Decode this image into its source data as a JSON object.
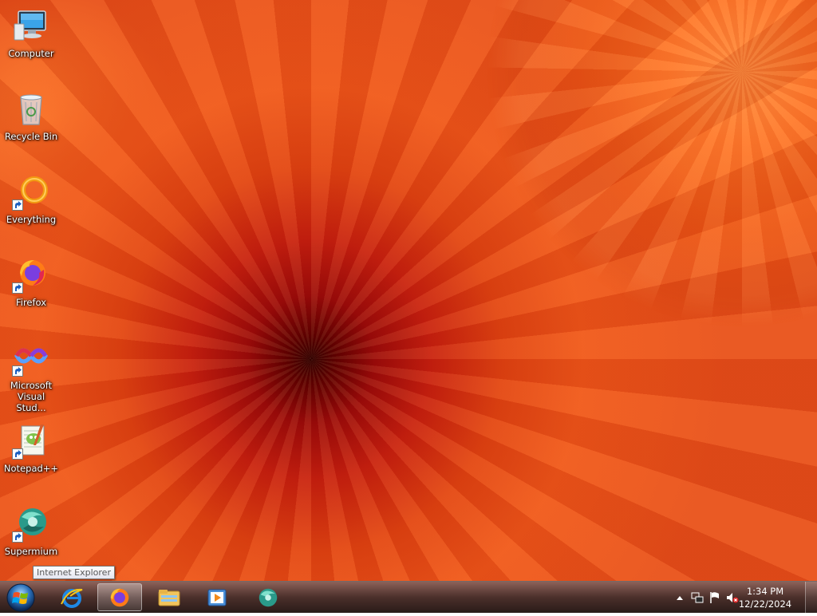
{
  "desktop": {
    "icons": [
      {
        "label": "Computer",
        "icon": "computer-icon"
      },
      {
        "label": "Recycle Bin",
        "icon": "recycle-bin-icon"
      },
      {
        "label": "Everything",
        "icon": "everything-icon"
      },
      {
        "label": "Firefox",
        "icon": "firefox-icon"
      },
      {
        "label": "Microsoft Visual Stud...",
        "icon": "visual-studio-icon"
      },
      {
        "label": "Notepad++",
        "icon": "notepad-plus-plus-icon"
      },
      {
        "label": "Supermium",
        "icon": "supermium-icon"
      }
    ]
  },
  "tooltip": {
    "text": "Internet Explorer"
  },
  "taskbar": {
    "start": {
      "icon": "windows-start-icon"
    },
    "pinned": [
      {
        "icon": "internet-explorer-icon"
      },
      {
        "icon": "firefox-icon",
        "active": true
      },
      {
        "icon": "file-explorer-icon"
      },
      {
        "icon": "media-player-icon"
      },
      {
        "icon": "supermium-icon"
      }
    ]
  },
  "tray": {
    "icons": [
      "show-hidden-icons-icon",
      "network-icon",
      "action-center-flag-icon",
      "volume-muted-icon"
    ],
    "time": "1:34 PM",
    "date": "12/22/2024"
  }
}
